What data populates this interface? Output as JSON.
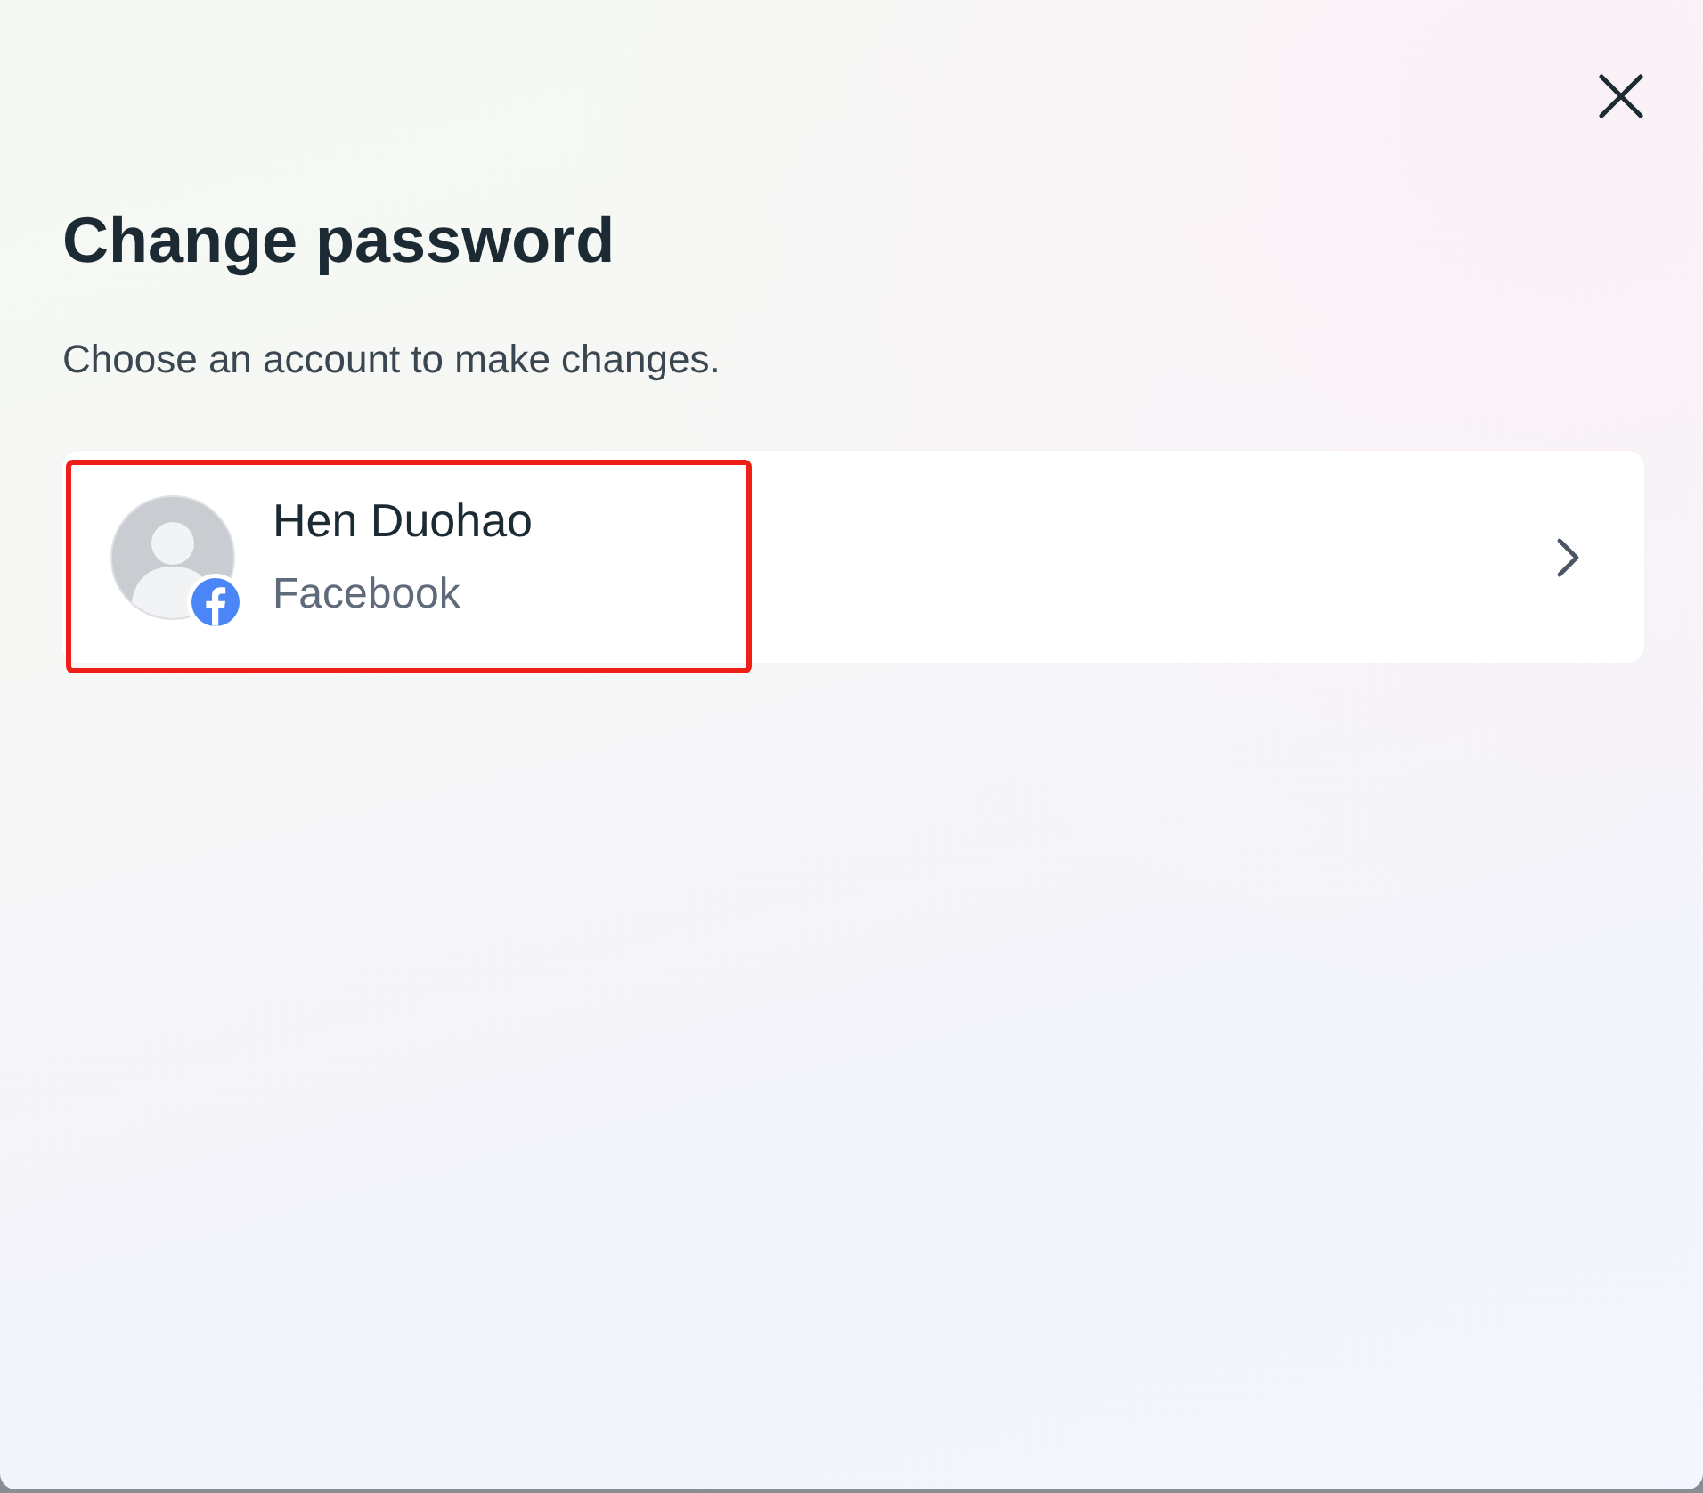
{
  "dialog": {
    "title": "Change password",
    "subtitle": "Choose an account to make changes.",
    "accounts": [
      {
        "name": "Hen Duohao",
        "platform": "Facebook",
        "highlighted": true
      }
    ]
  }
}
